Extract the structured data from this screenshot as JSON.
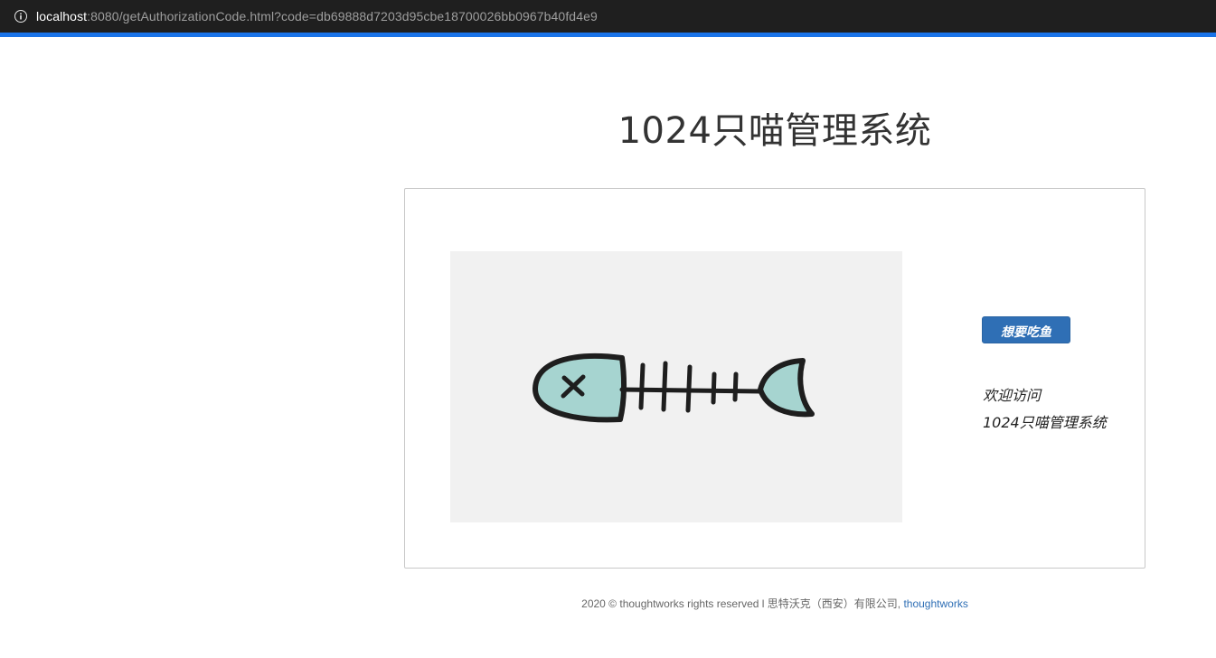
{
  "browser": {
    "url_host": "localhost",
    "url_rest": ":8080/getAuthorizationCode.html?code=db69888d7203d95cbe18700026bb0967b40fd4e9",
    "info_icon": "info-icon"
  },
  "page": {
    "title": "1024只喵管理系统"
  },
  "card": {
    "image_icon": "fish-skeleton-icon",
    "button_label": "想要吃鱼",
    "welcome_line1": "欢迎访问",
    "welcome_line2": "1024只喵管理系统"
  },
  "footer": {
    "text": "2020 © thoughtworks rights reserved l 思特沃克（西安）有限公司,",
    "link_text": "thoughtworks"
  },
  "colors": {
    "accent": "#2f6fb5",
    "progress": "#1a73e8",
    "fish_fill": "#a6d4d0",
    "fish_outline": "#1e1e1e"
  }
}
